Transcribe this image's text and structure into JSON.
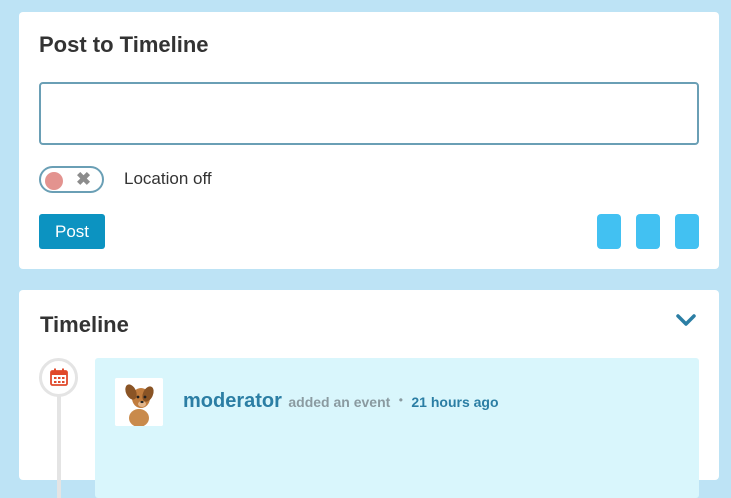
{
  "post_card": {
    "title": "Post to Timeline",
    "textarea_value": "",
    "location_toggle": {
      "state": "off",
      "label": "Location off"
    },
    "post_button": "Post"
  },
  "timeline": {
    "title": "Timeline",
    "events": [
      {
        "username": "moderator",
        "action": "added an event",
        "separator": "•",
        "time": "21 hours ago"
      }
    ]
  },
  "colors": {
    "background": "#bde3f5",
    "primary_button": "#0c93c1",
    "attach_button": "#42c1f2",
    "event_bg": "#d9f6fc",
    "link": "#2b7ea4",
    "toggle_off_knob": "#e3938f"
  },
  "icons": [
    "close-icon",
    "chevron-down-icon",
    "calendar-icon"
  ]
}
